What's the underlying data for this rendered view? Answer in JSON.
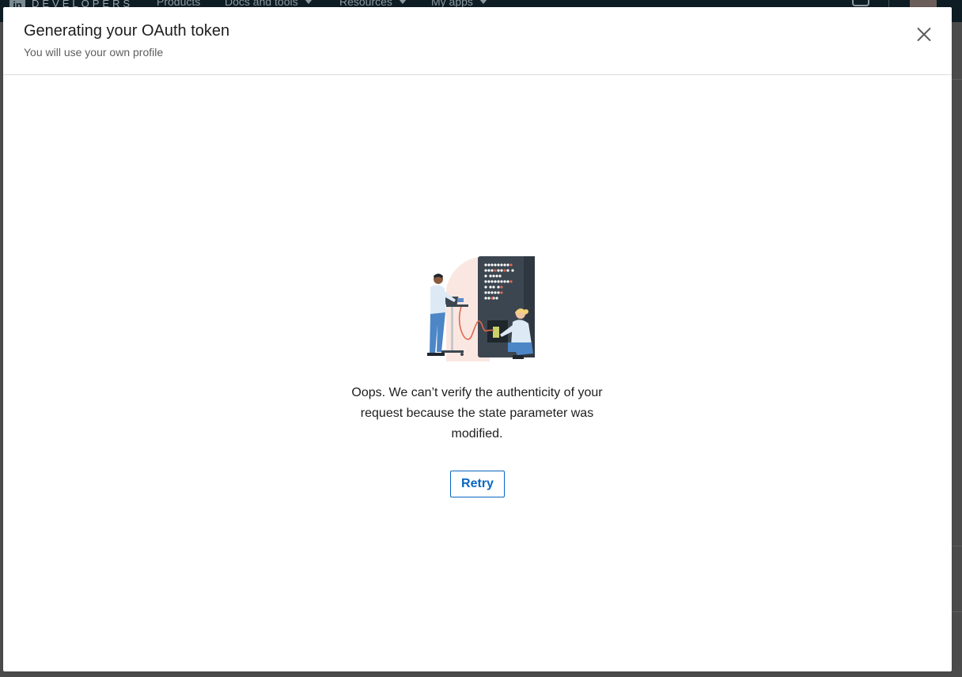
{
  "background": {
    "logo_text": "DEVELOPERS",
    "nav_items": [
      "Products",
      "Docs and tools",
      "Resources",
      "My apps"
    ]
  },
  "modal": {
    "title": "Generating your OAuth token",
    "subtitle": "You will use your own profile",
    "close_icon": "close-icon",
    "illustration": "people-fixing-server-illustration",
    "message": "Oops. We can’t verify the authenticity of your request because the state parameter was modified.",
    "retry_label": "Retry"
  },
  "colors": {
    "accent": "#0a66c2",
    "nav_bg": "#0e1c24",
    "overlay": "#4b4b4b"
  }
}
